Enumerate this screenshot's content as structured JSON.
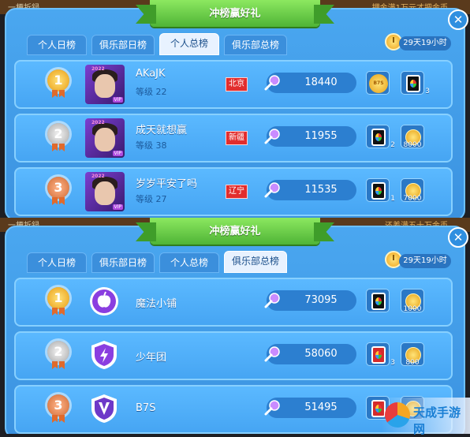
{
  "panels": [
    {
      "strip_left": "一梗折録",
      "strip_right": "押金满1万元才把金币",
      "banner": "冲榜赢好礼",
      "close": "✕",
      "tabs": [
        {
          "label": "个人日榜",
          "active": false
        },
        {
          "label": "俱乐部日榜",
          "active": false
        },
        {
          "label": "个人总榜",
          "active": true
        },
        {
          "label": "俱乐部总榜",
          "active": false
        }
      ],
      "timer": "29天19小时",
      "rows": [
        {
          "rank": "1",
          "name": "AKaJK",
          "level": "等级 22",
          "city": "北京",
          "score": "18440",
          "prize1": {
            "kind": "badge",
            "text": "B7S",
            "count": ""
          },
          "prize2": {
            "kind": "card",
            "count": "3"
          }
        },
        {
          "rank": "2",
          "name": "成天就想赢",
          "level": "等级 38",
          "city": "新疆",
          "score": "11955",
          "prize1": {
            "kind": "card",
            "count": "2"
          },
          "prize2": {
            "kind": "coin",
            "amount": "8000"
          }
        },
        {
          "rank": "3",
          "name": "岁岁平安了吗",
          "level": "等级 27",
          "city": "辽宁",
          "score": "11535",
          "prize1": {
            "kind": "card",
            "count": "1"
          },
          "prize2": {
            "kind": "coin",
            "amount": "7000"
          }
        }
      ]
    },
    {
      "strip_left": "一梗折録",
      "strip_right": "还差满五十万金币",
      "banner": "冲榜赢好礼",
      "close": "✕",
      "tabs": [
        {
          "label": "个人日榜",
          "active": false
        },
        {
          "label": "俱乐部日榜",
          "active": false
        },
        {
          "label": "个人总榜",
          "active": false
        },
        {
          "label": "俱乐部总榜",
          "active": true
        }
      ],
      "timer": "29天19小时",
      "rows": [
        {
          "rank": "1",
          "name": "魔法小铺",
          "icon": "apple-icon",
          "icon_color": "#8a3ee0",
          "score": "73095",
          "prize1": {
            "kind": "card",
            "count": ""
          },
          "prize2": {
            "kind": "coin",
            "amount": "1000"
          }
        },
        {
          "rank": "2",
          "name": "少年团",
          "icon": "lightning-shield-icon",
          "icon_color": "#8a3ee0",
          "score": "58060",
          "prize1": {
            "kind": "card-red",
            "count": "3"
          },
          "prize2": {
            "kind": "coin",
            "amount": "800"
          }
        },
        {
          "rank": "3",
          "name": "B7S",
          "icon": "v-shield-icon",
          "icon_color": "#6d38c8",
          "score": "51495",
          "prize1": {
            "kind": "card-red",
            "count": ""
          },
          "prize2": {
            "kind": "coin",
            "amount": ""
          }
        }
      ]
    }
  ],
  "watermark": "天成手游网",
  "colors": {
    "accent": "#4aa7f0",
    "banner": "#6fd24a",
    "city": "#e22d2d"
  }
}
